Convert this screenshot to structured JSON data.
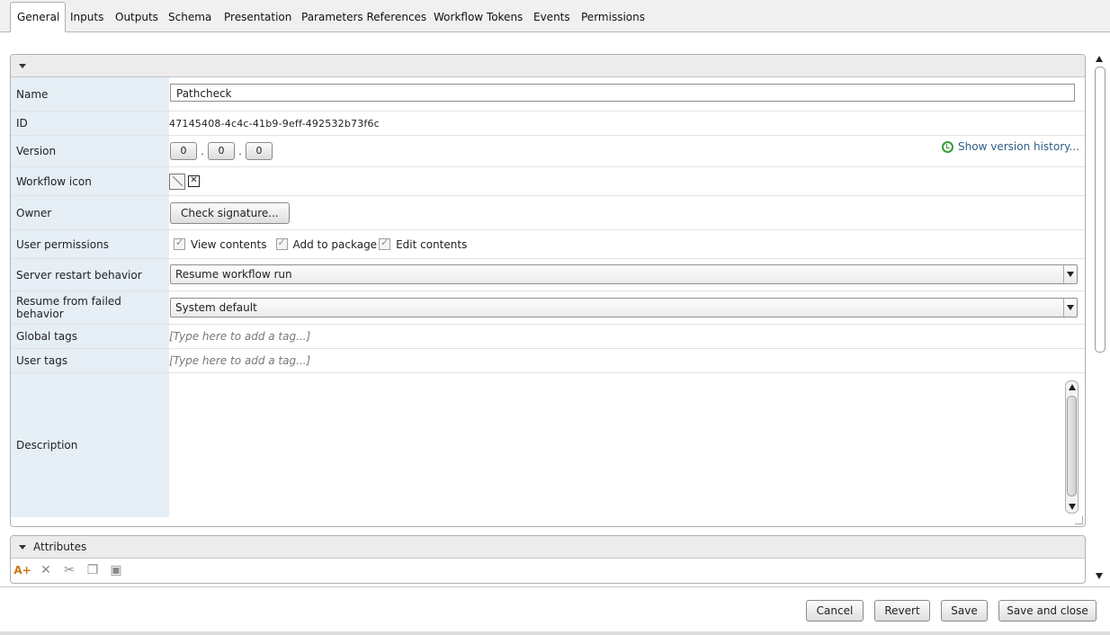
{
  "tabs": [
    {
      "label": "General",
      "active": true
    },
    {
      "label": "Inputs"
    },
    {
      "label": "Outputs"
    },
    {
      "label": "Schema"
    },
    {
      "label": "Presentation"
    },
    {
      "label": "Parameters References"
    },
    {
      "label": "Workflow Tokens"
    },
    {
      "label": "Events"
    },
    {
      "label": "Permissions"
    }
  ],
  "general": {
    "name_label": "Name",
    "name_value": "Pathcheck",
    "id_label": "ID",
    "id_value": "47145408-4c4c-41b9-9eff-492532b73f6c",
    "version_label": "Version",
    "version": [
      "0",
      "0",
      "0"
    ],
    "version_sep": ".",
    "history_link": "Show version history...",
    "icon_label": "Workflow icon",
    "owner_label": "Owner",
    "check_signature": "Check signature...",
    "permissions_label": "User permissions",
    "permissions": [
      "View contents",
      "Add to package",
      "Edit contents"
    ],
    "restart_label": "Server restart behavior",
    "restart_value": "Resume workflow run",
    "resume_label": "Resume from failed behavior",
    "resume_value": "System default",
    "global_tags_label": "Global tags",
    "global_tags_placeholder": "[Type here to add a tag...]",
    "user_tags_label": "User tags",
    "user_tags_placeholder": "[Type here to add a tag...]",
    "description_label": "Description",
    "description_value": ""
  },
  "attributes": {
    "title": "Attributes",
    "tools": [
      "add-attribute-icon",
      "delete-icon",
      "cut-icon",
      "copy-icon",
      "paste-icon"
    ]
  },
  "footer": {
    "cancel": "Cancel",
    "revert": "Revert",
    "save": "Save",
    "save_close": "Save and close"
  }
}
